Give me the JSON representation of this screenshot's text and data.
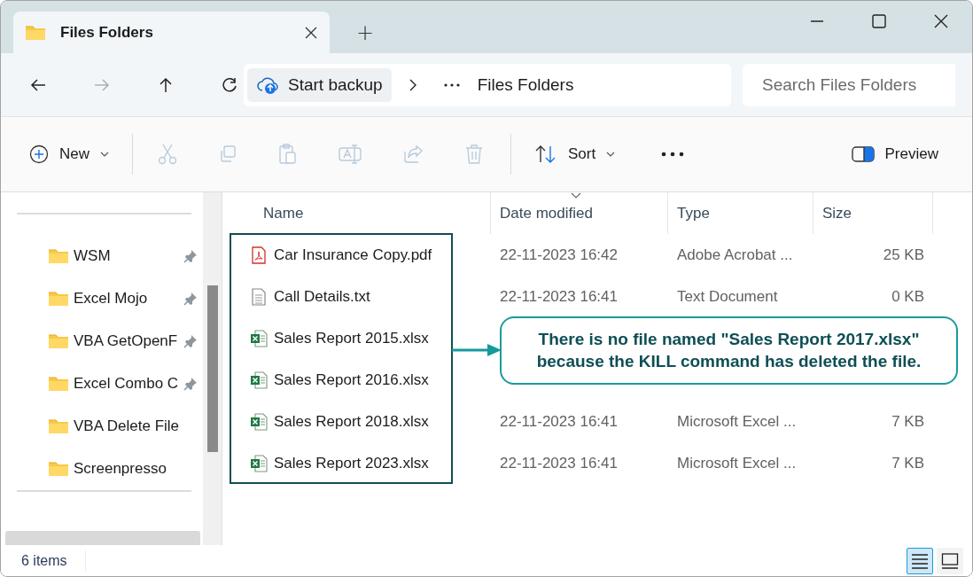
{
  "window": {
    "tab": {
      "title": "Files Folders",
      "selected": true
    },
    "new_tab": "+"
  },
  "navigation": {
    "buttons": [
      {
        "kind": "back",
        "disabled": false
      },
      {
        "kind": "forward",
        "disabled": true
      },
      {
        "kind": "up",
        "disabled": false
      },
      {
        "kind": "refresh",
        "disabled": false
      }
    ],
    "address": {
      "backup": "Start backup",
      "location": "Files Folders"
    },
    "search": {
      "placeholder": "Search Files Folders"
    }
  },
  "toolbar": {
    "new": "New",
    "tools": [
      {
        "kind": "cut",
        "disabled": true
      },
      {
        "kind": "copy",
        "disabled": true
      },
      {
        "kind": "paste",
        "disabled": true
      },
      {
        "kind": "rename",
        "disabled": true
      },
      {
        "kind": "share",
        "disabled": true
      },
      {
        "kind": "delete",
        "disabled": true
      }
    ],
    "sort": "Sort",
    "preview": "Preview"
  },
  "sidebar": {
    "items": [
      {
        "label": "WSM",
        "pinned": true
      },
      {
        "label": "Excel Mojo",
        "pinned": true
      },
      {
        "label": "VBA GetOpenF",
        "pinned": true
      },
      {
        "label": "Excel Combo C",
        "pinned": true
      },
      {
        "label": "VBA Delete File",
        "pinned": false
      },
      {
        "label": "Screenpresso",
        "pinned": false
      }
    ]
  },
  "file_list": {
    "columns": [
      {
        "label": "Name",
        "sorted": false
      },
      {
        "label": "Date modified",
        "sorted": true
      },
      {
        "label": "Type",
        "sorted": false
      },
      {
        "label": "Size",
        "sorted": false
      }
    ],
    "rows": [
      {
        "name": "Car Insurance Copy.pdf",
        "kind": "pdf",
        "date": "22-11-2023 16:42",
        "type": "Adobe Acrobat ...",
        "size": "25 KB"
      },
      {
        "name": "Call Details.txt",
        "kind": "txt",
        "date": "22-11-2023 16:41",
        "type": "Text Document",
        "size": "0 KB"
      },
      {
        "name": "Sales Report 2015.xlsx",
        "kind": "xlsx"
      },
      {
        "name": "Sales Report 2016.xlsx",
        "kind": "xlsx"
      },
      {
        "name": "Sales Report 2018.xlsx",
        "kind": "xlsx",
        "date": "22-11-2023 16:41",
        "type": "Microsoft Excel ...",
        "size": "7 KB"
      },
      {
        "name": "Sales Report 2023.xlsx",
        "kind": "xlsx",
        "date": "22-11-2023 16:41",
        "type": "Microsoft Excel ...",
        "size": "7 KB"
      }
    ]
  },
  "callout": {
    "text": "There is no file named \"Sales Report 2017.xlsx\"\nbecause the KILL command has deleted the file."
  },
  "status_bar": {
    "count": "6 items",
    "views": [
      {
        "kind": "details",
        "selected": true
      },
      {
        "kind": "tiles",
        "selected": false
      }
    ]
  }
}
